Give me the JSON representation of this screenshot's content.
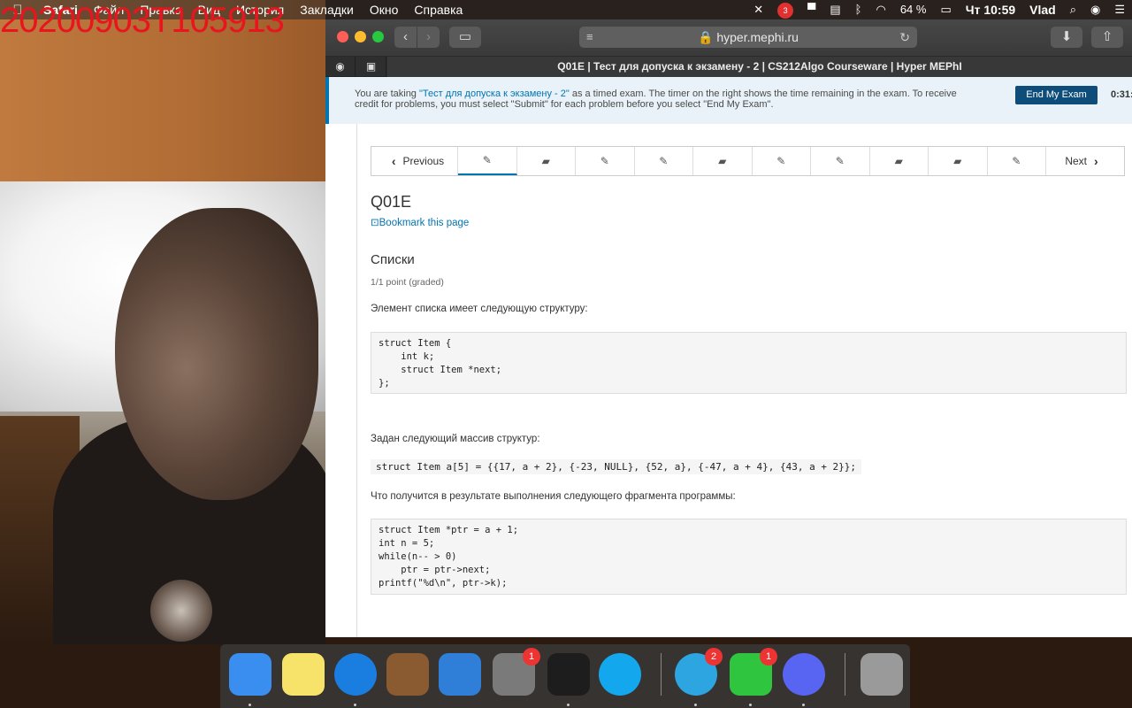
{
  "overlay": {
    "recording_text": "20200903T105913"
  },
  "menubar": {
    "app": "Safari",
    "items": [
      "Файл",
      "Правка",
      "Вид",
      "История",
      "Закладки",
      "Окно",
      "Справка"
    ],
    "battery": "64 %",
    "clock": "Чт 10:59",
    "user": "Vlad",
    "badge_count": "3"
  },
  "browser": {
    "url": "hyper.mephi.ru",
    "tab_title": "Q01E | Тест для допуска к экзамену - 2 | CS212Algo Courseware | Hyper MEPhI"
  },
  "exam_banner": {
    "prefix": "You are taking ",
    "exam_link": "\"Тест для допуска к экзамену - 2\"",
    "suffix": " as a timed exam. The timer on the right shows the time remaining in the exam. To receive credit for problems, you must select \"Submit\" for each problem before you select \"End My Exam\".",
    "end_button": "End My Exam",
    "timer": "0:31:"
  },
  "sequence_nav": {
    "previous": "Previous",
    "next": "Next",
    "units": [
      "problem",
      "video",
      "problem",
      "problem",
      "video",
      "problem",
      "problem",
      "video",
      "video",
      "problem"
    ]
  },
  "unit": {
    "title": "Q01E",
    "bookmark": "Bookmark this page"
  },
  "problem": {
    "title": "Списки",
    "points": "1/1 point (graded)",
    "text1": "Элемент списка имеет следующую структуру:",
    "code1": "struct Item {\n    int k;\n    struct Item *next;\n};",
    "text2": "Задан следующий массив структур:",
    "code_inline": "struct Item a[5] = {{17, a + 2}, {-23, NULL}, {52, a}, {-47, a + 4}, {43, a + 2}};",
    "text3": "Что получится в результате выполнения следующего фрагмента программы:",
    "code2": "struct Item *ptr = a + 1;\nint n = 5;\nwhile(n-- > 0)\n    ptr = ptr->next;\nprintf(\"%d\\n\", ptr->k);"
  },
  "dock": {
    "items": [
      {
        "name": "finder",
        "color": "#3a8ef0"
      },
      {
        "name": "notes",
        "color": "#f7e36a"
      },
      {
        "name": "safari",
        "color": "#1a7de0"
      },
      {
        "name": "garageband",
        "color": "#8a5a30"
      },
      {
        "name": "xcode",
        "color": "#2f7fd8"
      },
      {
        "name": "system-preferences",
        "color": "#7a7a7a",
        "badge": "1"
      },
      {
        "name": "pycharm",
        "color": "#1d1d1d"
      },
      {
        "name": "skype",
        "color": "#13a8ed"
      },
      {
        "name": "telegram",
        "color": "#2ca5e0",
        "badge": "2"
      },
      {
        "name": "facetime",
        "color": "#2fc53e",
        "badge": "1"
      },
      {
        "name": "discord",
        "color": "#5865f2"
      },
      {
        "name": "trash",
        "color": "#9a9a9a"
      }
    ]
  }
}
